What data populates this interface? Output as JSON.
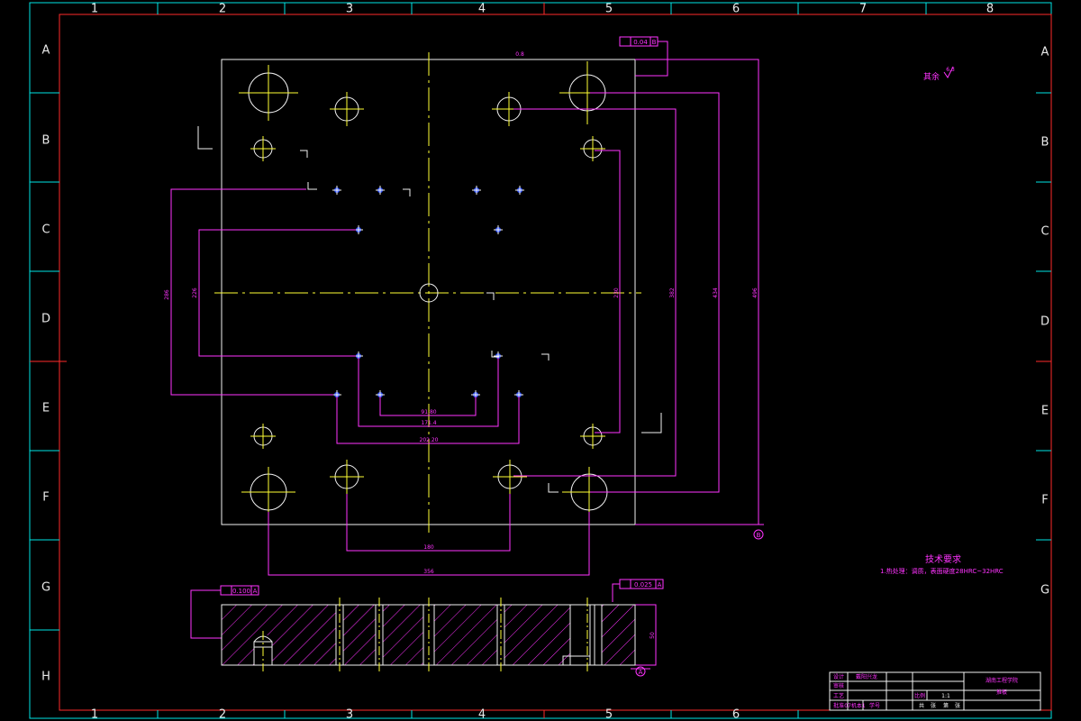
{
  "border": {
    "top_numbers": [
      "1",
      "2",
      "3",
      "4",
      "5",
      "6",
      "7",
      "8"
    ],
    "bottom_numbers": [
      "1",
      "2",
      "3",
      "4",
      "5",
      "6"
    ],
    "left_letters": [
      "A",
      "B",
      "C",
      "D",
      "E",
      "F",
      "G",
      "H"
    ],
    "right_letters": [
      "A",
      "B",
      "C",
      "D",
      "E",
      "F",
      "G"
    ]
  },
  "colors": {
    "frame_cyan": "#00e5e5",
    "frame_red": "#ff2a2a",
    "part_white": "#f2f2f2",
    "centerline_yellow": "#ffff33",
    "dimension_magenta": "#ff33ff",
    "hole_blue": "#3355ff",
    "hatch": "#ff33ff"
  },
  "annotations": {
    "roughness_note": "其余",
    "roughness_value": "6.3",
    "roughness_top": "0.8",
    "tech_title": "技术要求",
    "tech_item_1": "1.热处理：调质，表面硬度28HRC~32HRC",
    "flatness_frame_top": "0.04",
    "flatness_datum": "B",
    "flatness_frame_side": "0.100",
    "parallel_frame": "0.025",
    "datum_a": "A",
    "datum_letter_right": "B",
    "datum_letter_bottom": "A",
    "dim_vertical_1": "286",
    "dim_vertical_2": "226",
    "dim_vertical_3": "230",
    "dim_vertical_4": "382",
    "dim_vertical_5": "434",
    "dim_vertical_6": "496",
    "dim_horiz_1": "91.80",
    "dim_horiz_2": "171.4",
    "dim_horiz_3": "202.20",
    "dim_horiz_4": "180",
    "dim_horiz_5": "356",
    "dim_thickness": "50"
  },
  "title_block": {
    "row1_col1": "设计",
    "row1_col2": "戴阳兴龙",
    "row2_col1": "审核",
    "row3_col1": "工艺",
    "row4_col1": "批准",
    "row4_col2": "07机本1",
    "row4_col3": "学号",
    "school": "湖南工程学院",
    "part_name": "推板",
    "ratio_label": "比例",
    "ratio_value": "1:1",
    "sheet_1": "共",
    "sheet_2": "张",
    "sheet_3": "第",
    "sheet_4": "张"
  }
}
